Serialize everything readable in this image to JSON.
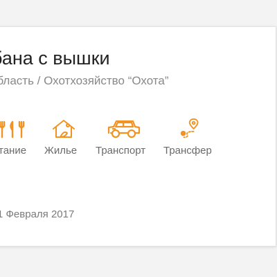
{
  "listing": {
    "title": "бана с вышки",
    "location": "область / Охотхозяйство “Охота”",
    "date": "1 Февраля 2017"
  },
  "amenities": [
    {
      "label": "тание",
      "icon": "cutlery-icon"
    },
    {
      "label": "Жилье",
      "icon": "house-icon"
    },
    {
      "label": "Транспорт",
      "icon": "jeep-icon"
    },
    {
      "label": "Трансфер",
      "icon": "route-pin-icon"
    }
  ],
  "colors": {
    "accent": "#f29321",
    "title": "#222222",
    "muted": "#888888",
    "card": "#ffffff",
    "background": "#f3f3f3"
  }
}
